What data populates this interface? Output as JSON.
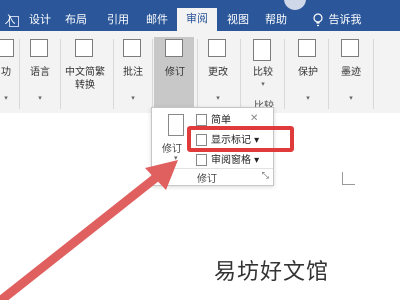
{
  "tabs": [
    {
      "label": "入",
      "active": false
    },
    {
      "label": "设计",
      "active": false
    },
    {
      "label": "布局",
      "active": false
    },
    {
      "label": "引用",
      "active": false
    },
    {
      "label": "邮件",
      "active": false
    },
    {
      "label": "审阅",
      "active": true
    },
    {
      "label": "视图",
      "active": false
    },
    {
      "label": "帮助",
      "active": false
    },
    {
      "label": "告诉我",
      "active": false
    }
  ],
  "ribbon": {
    "groups": [
      {
        "label": "功",
        "icon": "check-icon"
      },
      {
        "label": "语言",
        "icon": "language-icon"
      },
      {
        "label": "中文简繁\n转换",
        "icon": "chinese-convert-icon"
      },
      {
        "label": "批注",
        "icon": "comment-icon"
      },
      {
        "label": "修订",
        "icon": "track-changes-icon"
      },
      {
        "label": "更改",
        "icon": "changes-icon"
      },
      {
        "label": "比较",
        "icon": "compare-icon"
      },
      {
        "label": "保护",
        "icon": "protect-icon"
      },
      {
        "label": "墨迹",
        "icon": "ink-icon"
      }
    ],
    "compare_group_label": "比较"
  },
  "dropdown": {
    "side_label": "修订",
    "items": [
      {
        "label": "简单",
        "icon": "markup-view-icon"
      },
      {
        "label": "显示标记",
        "icon": "show-markup-icon"
      },
      {
        "label": "审阅窗格",
        "icon": "reviewing-pane-icon"
      }
    ],
    "footer_label": "修订",
    "highlighted_item": "显示标记"
  },
  "accent_color": "#2b579a",
  "highlight_color": "#e03b3b",
  "watermark": "易坊好文馆"
}
